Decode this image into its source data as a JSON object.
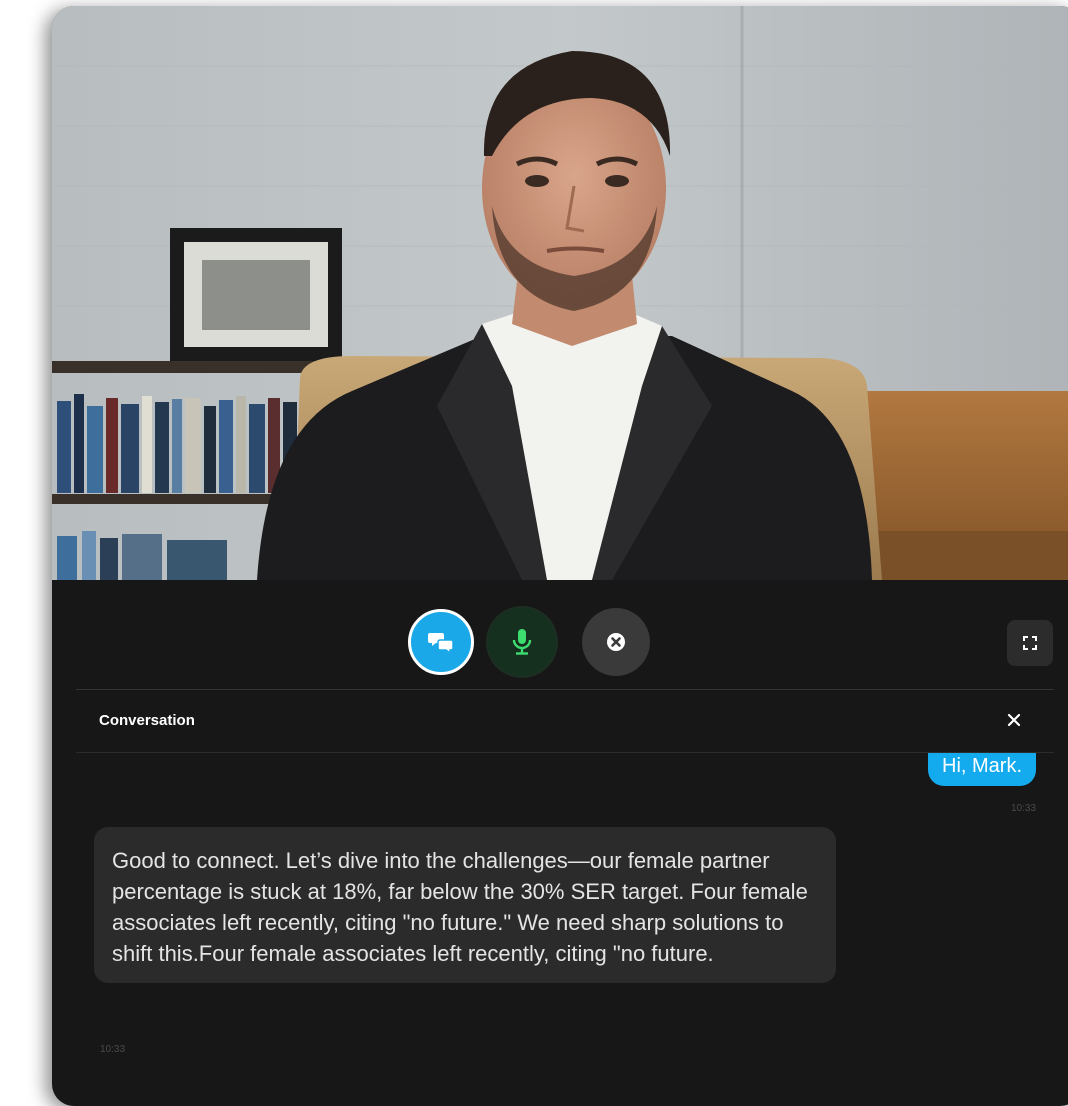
{
  "controls": {
    "chat_toggle_icon": "chat-bubbles-icon",
    "mic_icon": "microphone-icon",
    "end_icon": "close-circle-icon",
    "fullscreen_icon": "fullscreen-icon"
  },
  "conversation": {
    "title": "Conversation",
    "close_icon": "close-icon",
    "messages": [
      {
        "role": "user",
        "text": "Hi, Mark.",
        "time": "10:33"
      },
      {
        "role": "assistant",
        "text": "Good to connect. Let’s dive into the challenges—our female partner percentage is stuck at 18%, far below the 30% SER target. Four female associates left recently, citing \"no future.\" We need sharp solutions to shift this.Four female associates left recently, citing \"no future.",
        "time": "10:33"
      }
    ]
  },
  "colors": {
    "accent": "#14aaee",
    "mic_green": "#3ddc6f",
    "panel_bg": "#171717",
    "bubble_bg": "#2b2b2b"
  }
}
